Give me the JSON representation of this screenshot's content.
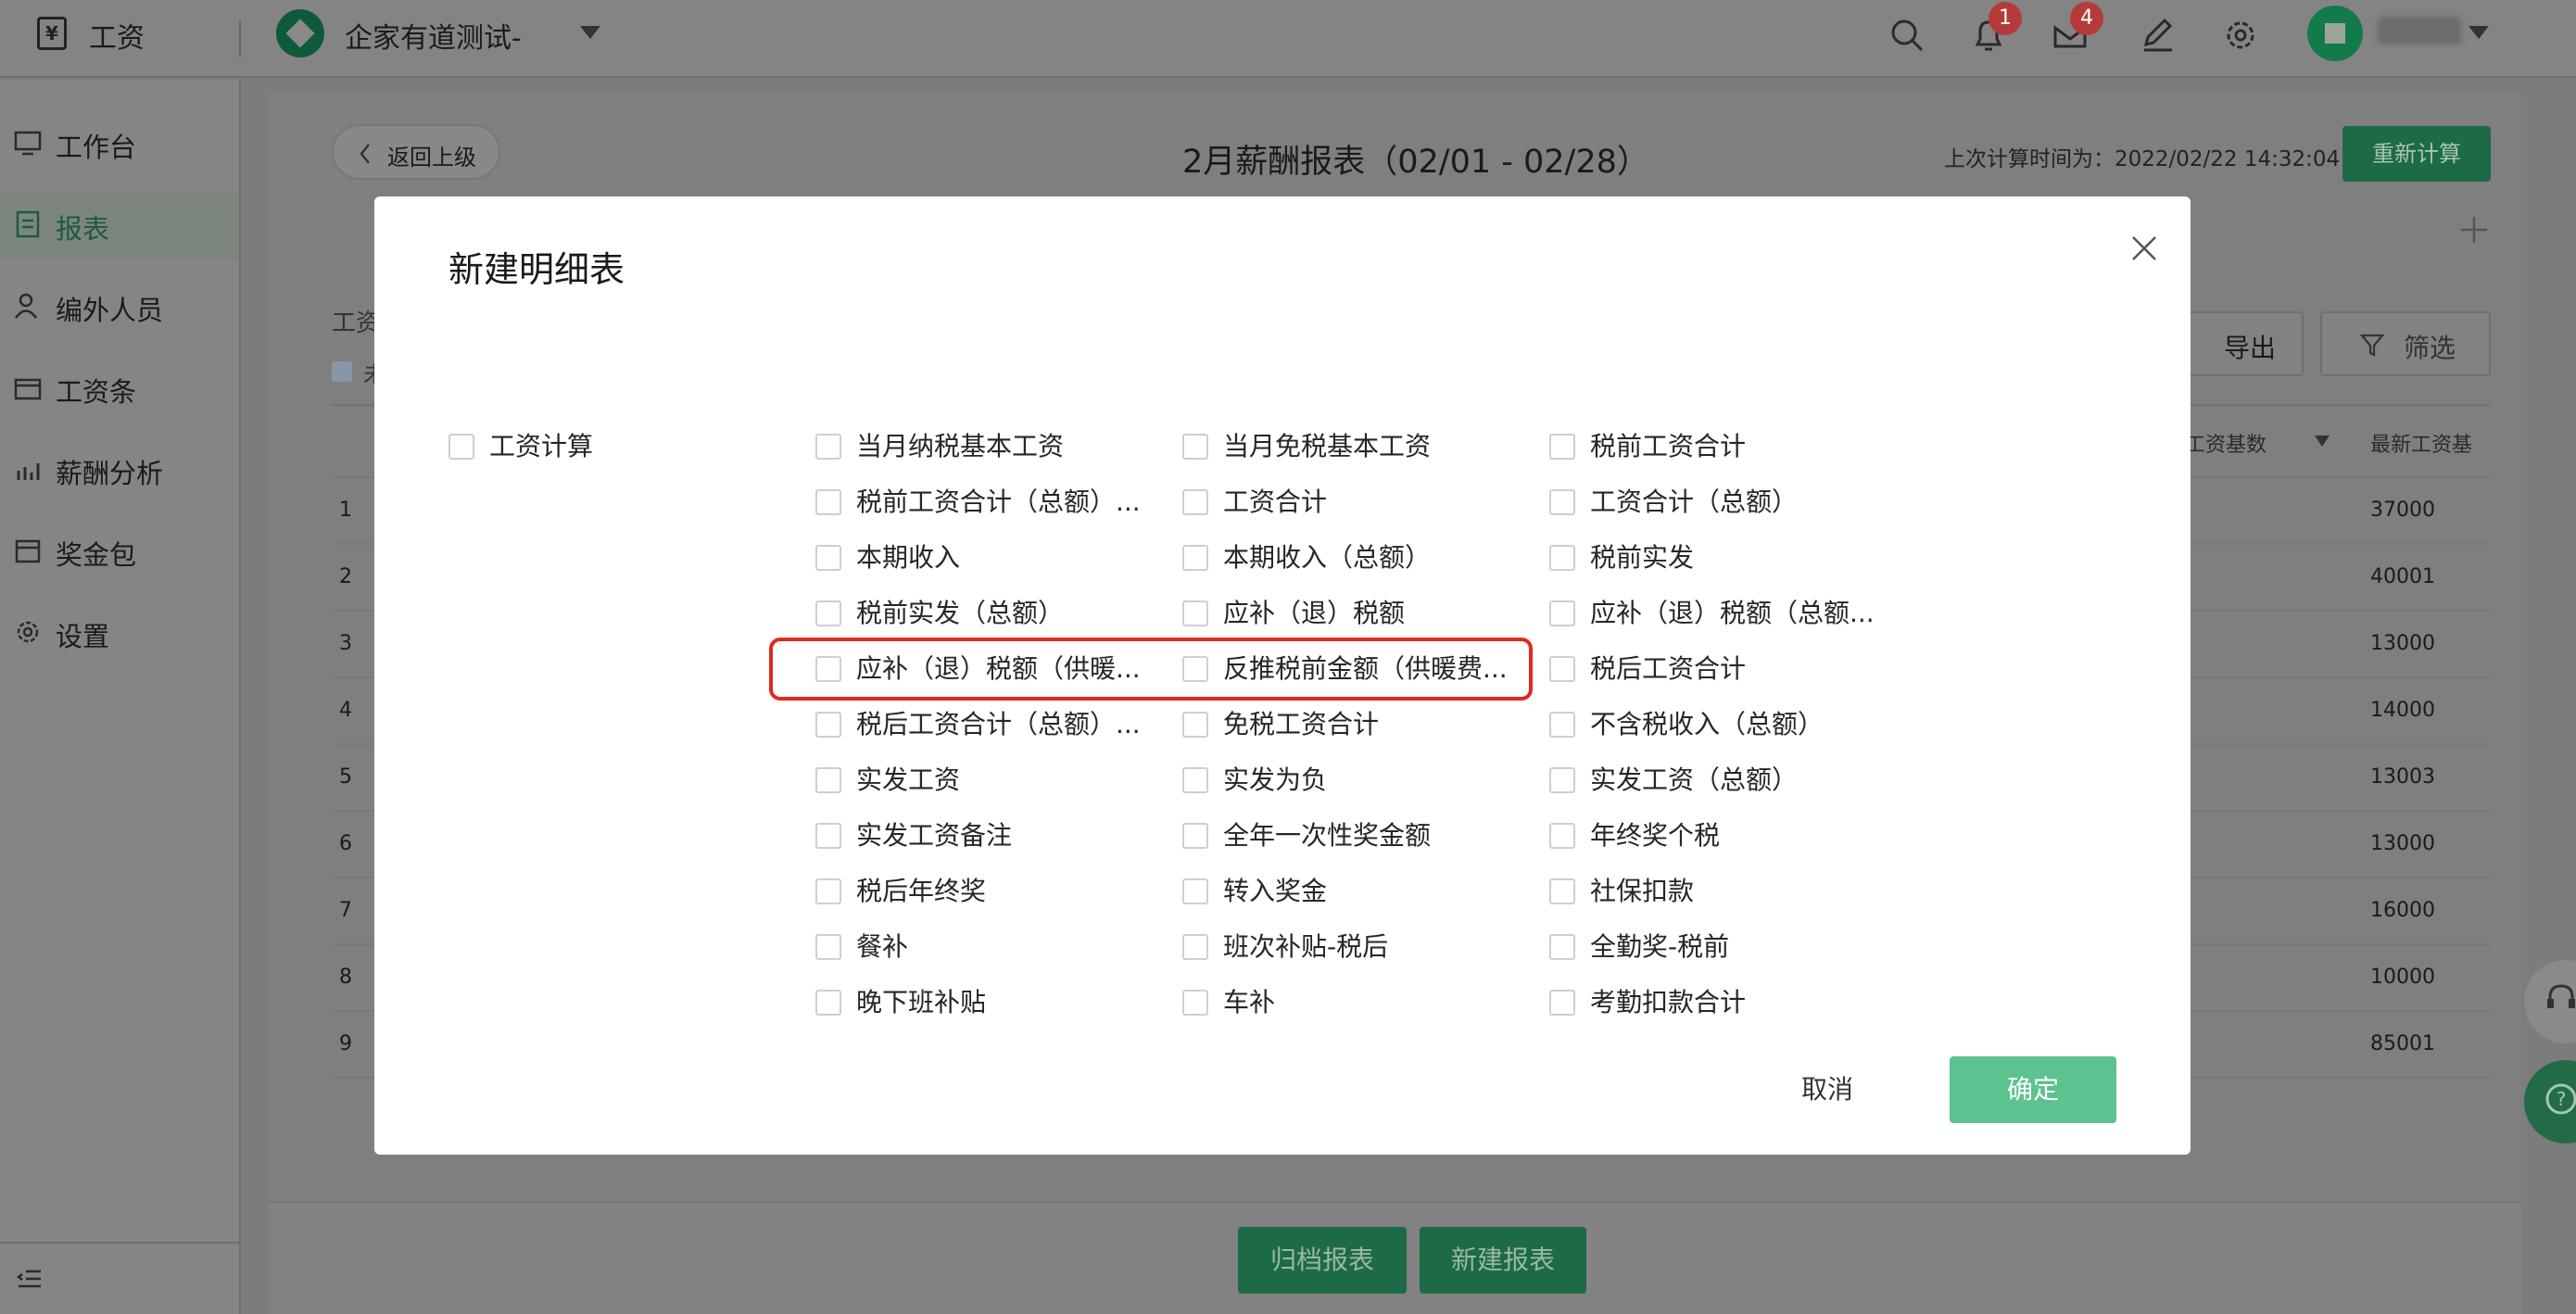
{
  "topbar": {
    "app_title": "工资",
    "company_name": "企家有道测试-",
    "notification_count": "1",
    "message_count": "4"
  },
  "sidebar": {
    "items": [
      {
        "label": "工作台",
        "icon": "monitor-icon"
      },
      {
        "label": "报表",
        "icon": "report-icon",
        "active": true
      },
      {
        "label": "编外人员",
        "icon": "person-icon"
      },
      {
        "label": "工资条",
        "icon": "wallet-icon"
      },
      {
        "label": "薪酬分析",
        "icon": "chart-icon"
      },
      {
        "label": "奖金包",
        "icon": "box-icon"
      },
      {
        "label": "设置",
        "icon": "gear-icon"
      }
    ]
  },
  "page": {
    "back_label": "返回上级",
    "title": "2月薪酬报表（02/01 - 02/28）",
    "last_calc": "上次计算时间为：2022/02/22 14:32:04",
    "recalc_label": "重新计算",
    "section_label": "工资",
    "chip_label": "未",
    "export_label": "导出",
    "filter_label": "筛选",
    "table": {
      "headers": [
        "岗位工资基数",
        "最新工资基"
      ],
      "rows": [
        {
          "idx": "1",
          "value": "37000"
        },
        {
          "idx": "2",
          "value": "40001"
        },
        {
          "idx": "3",
          "value": "13000"
        },
        {
          "idx": "4",
          "value": "14000"
        },
        {
          "idx": "5",
          "value": "13003"
        },
        {
          "idx": "6",
          "value": "13000"
        },
        {
          "idx": "7",
          "value": "16000"
        },
        {
          "idx": "8",
          "value": "10000"
        },
        {
          "idx": "9",
          "value": "85001"
        }
      ]
    },
    "archive_label": "归档报表",
    "new_report_label": "新建报表"
  },
  "modal": {
    "title": "新建明细表",
    "group_label": "工资计算",
    "options": [
      "当月纳税基本工资",
      "当月免税基本工资",
      "税前工资合计",
      "税前工资合计（总额）...",
      "工资合计",
      "工资合计（总额）",
      "本期收入",
      "本期收入（总额）",
      "税前实发",
      "税前实发（总额）",
      "应补（退）税额",
      "应补（退）税额（总额...",
      "应补（退）税额（供暖...",
      "反推税前金额（供暖费...",
      "税后工资合计",
      "税后工资合计（总额）...",
      "免税工资合计",
      "不含税收入（总额）",
      "实发工资",
      "实发为负",
      "实发工资（总额）",
      "实发工资备注",
      "全年一次性奖金额",
      "年终奖个税",
      "税后年终奖",
      "转入奖金",
      "社保扣款",
      "餐补",
      "班次补贴-税后",
      "全勤奖-税前",
      "晚下班补贴",
      "车补",
      "考勤扣款合计"
    ],
    "cancel_label": "取消",
    "confirm_label": "确定"
  },
  "colors": {
    "brand_green": "#5cc28f",
    "highlight_red": "#e0291f"
  }
}
